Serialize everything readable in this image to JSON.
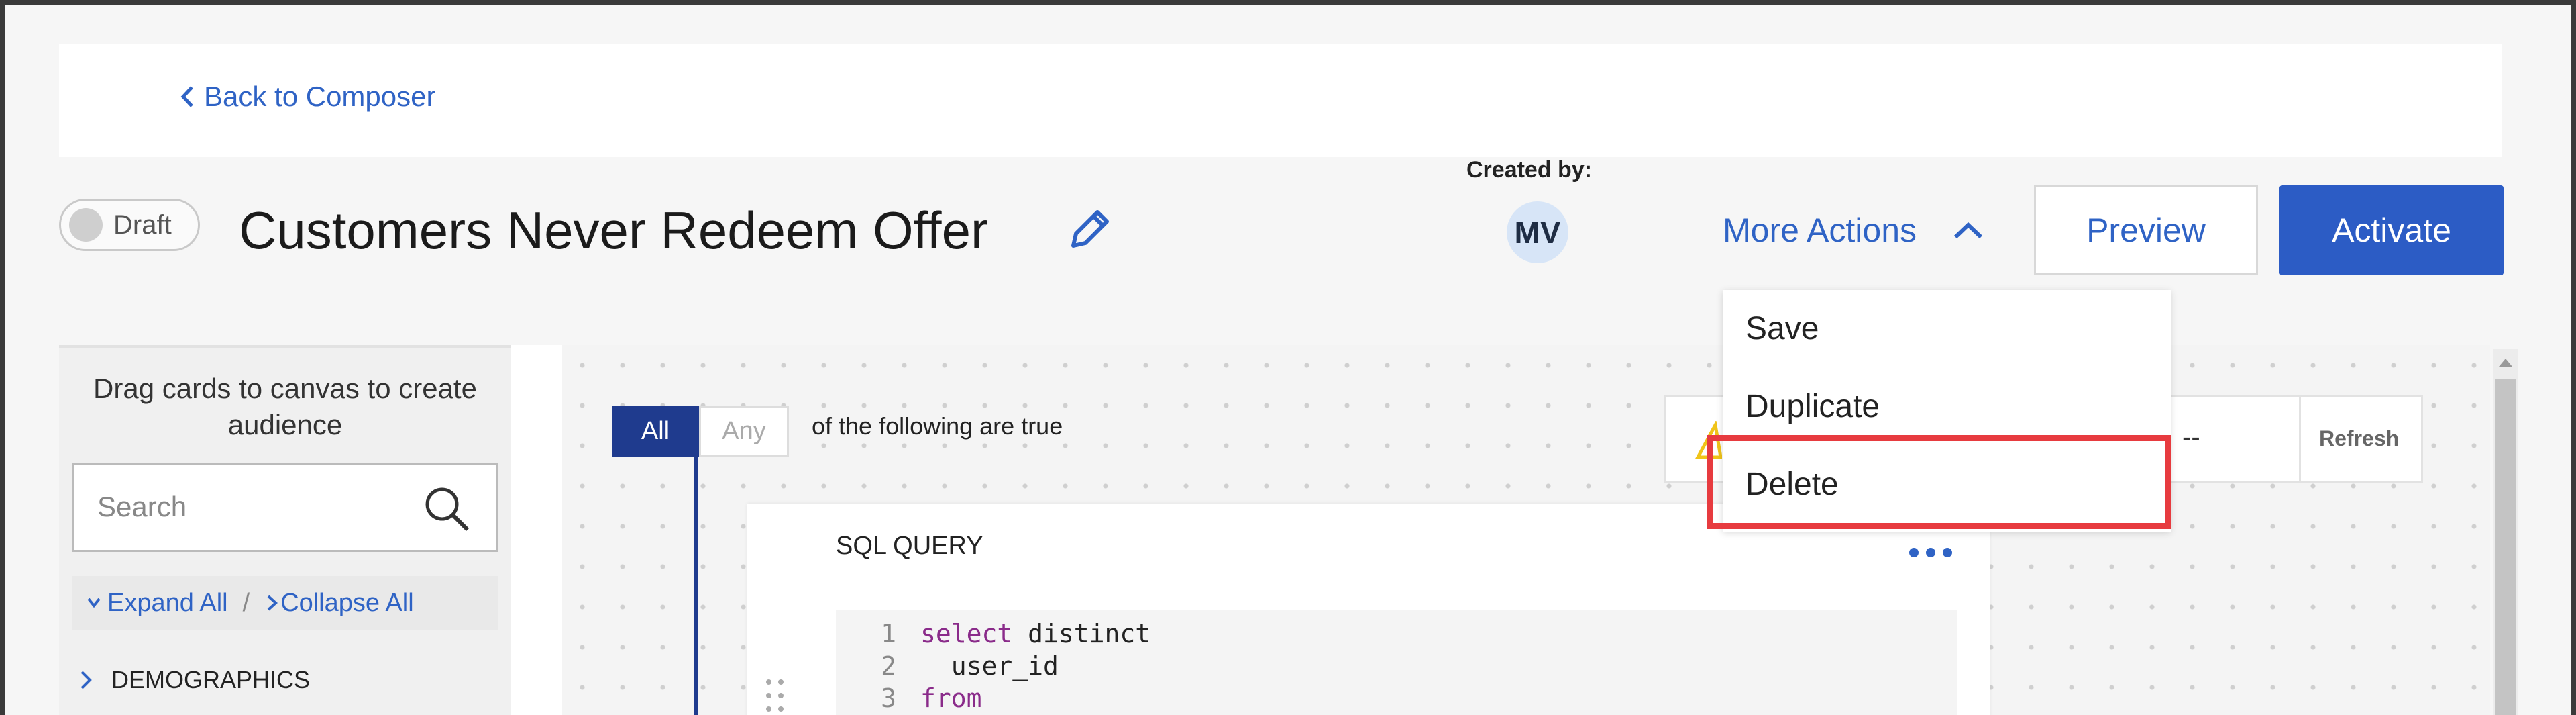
{
  "nav": {
    "back_label": "Back to Composer"
  },
  "header": {
    "status": "Draft",
    "title": "Customers Never Redeem Offer",
    "created_by_label": "Created by:",
    "creator_initials": "MV",
    "more_actions_label": "More Actions",
    "preview_label": "Preview",
    "activate_label": "Activate"
  },
  "more_actions_menu": {
    "items": [
      "Save",
      "Duplicate",
      "Delete"
    ],
    "highlighted": "Delete"
  },
  "sidebar": {
    "hint": "Drag cards to canvas to create audience",
    "search_placeholder": "Search",
    "expand_all": "Expand All",
    "separator": "/",
    "collapse_all": "Collapse All",
    "sections": [
      "DEMOGRAPHICS"
    ]
  },
  "canvas": {
    "match_all": "All",
    "match_any": "Any",
    "condition_text": "of the following are true",
    "sql_card": {
      "title": "SQL QUERY",
      "code_lines": [
        {
          "num": "1",
          "keyword": "select",
          "text": " distinct"
        },
        {
          "num": "2",
          "keyword": "",
          "text": "  user_id"
        },
        {
          "num": "3",
          "keyword": "from",
          "text": ""
        }
      ]
    },
    "count_card": {
      "value": "--",
      "refresh_label": "Refresh"
    }
  },
  "colors": {
    "accent": "#2f63c5",
    "activate_bg": "#2c5cc5",
    "toggle_active": "#1f3b8e",
    "highlight_border": "#e73b3f",
    "sql_keyword": "#8a2b8a"
  },
  "icons": [
    "chevron-left-icon",
    "pencil-icon",
    "chevron-up-icon",
    "search-icon",
    "chevron-down-icon",
    "chevron-right-icon",
    "more-horizontal-icon",
    "drag-handle-icon",
    "warning-icon",
    "scroll-up-arrow-icon"
  ]
}
